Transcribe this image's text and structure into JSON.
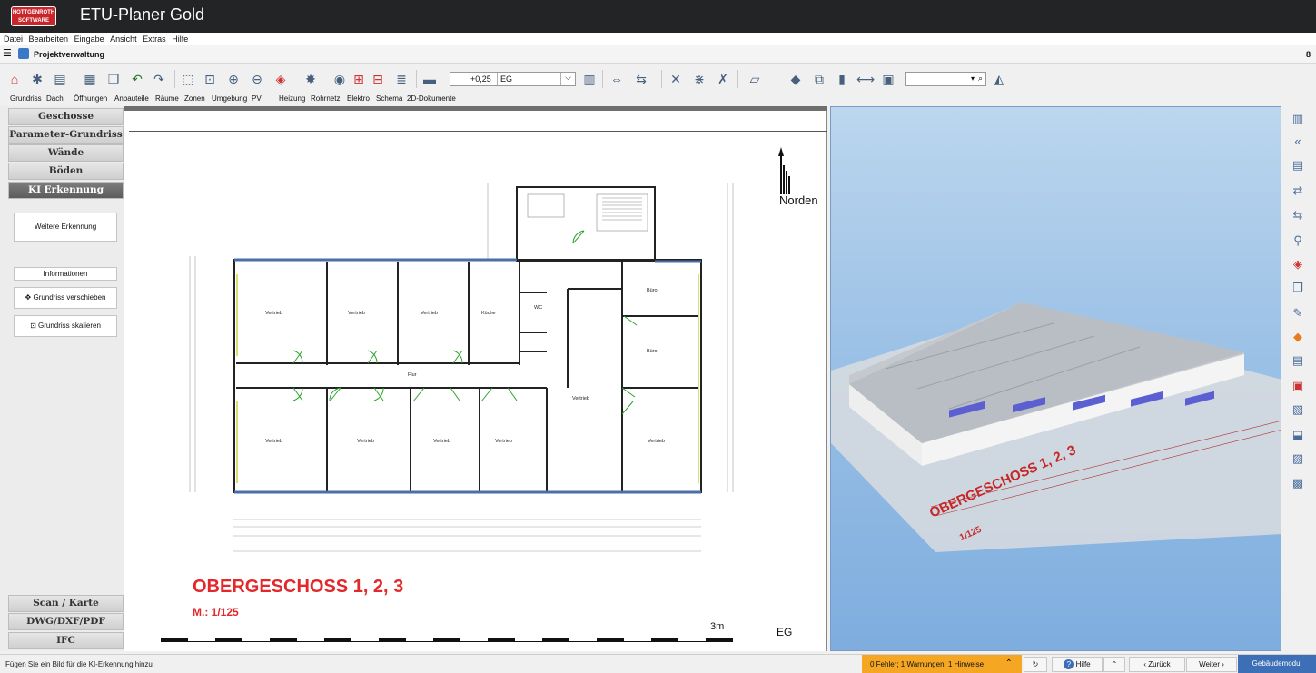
{
  "app": {
    "title": "ETU-Planer Gold",
    "logo_line1": "HOTTGENROTH",
    "logo_line2": "SOFTWARE"
  },
  "menu": [
    "Datei",
    "Bearbeiten",
    "Eingabe",
    "Ansicht",
    "Extras",
    "Hilfe"
  ],
  "project": {
    "title": "Projektverwaltung",
    "number": "8"
  },
  "toolbar": {
    "level_value": "+0,25",
    "level_name": "EG",
    "search_placeholder": ""
  },
  "tabs": [
    "Grundriss",
    "Dach",
    "Öffnungen",
    "Anbauteile",
    "Räume",
    "Zonen",
    "Umgebung",
    "PV",
    "Heizung",
    "Rohrnetz",
    "Elektro",
    "Schema",
    "2D-Dokumente"
  ],
  "left_nav": {
    "top": [
      "Geschosse",
      "Parameter-Grundriss",
      "Wände",
      "Böden",
      "KI Erkennung"
    ],
    "active": "KI Erkennung",
    "bottom": [
      "Scan / Karte",
      "DWG/DXF/PDF",
      "IFC"
    ]
  },
  "ki_panel": {
    "weitere": "Weitere Erkennung",
    "informationen": "Informationen",
    "verschieben": "Grundriss verschieben",
    "skalieren": "Grundriss skalieren"
  },
  "drawing": {
    "north_label": "Norden",
    "floor_title": "OBERGESCHOSS 1, 2, 3",
    "floor_scale": "M.: 1/125",
    "scale_text": "3m",
    "level_tag": "EG",
    "rooms": [
      "Vertrieb",
      "Vertrieb",
      "Vertrieb",
      "Küche",
      "WC",
      "Büro",
      "Büro",
      "Flur",
      "Vertrieb",
      "Vertrieb",
      "Vertrieb",
      "Vertrieb",
      "Vertrieb",
      "Vertrieb"
    ]
  },
  "view3d": {
    "floor_title": "OBERGESCHOSS 1, 2, 3",
    "floor_scale": "1/125"
  },
  "status": {
    "hint": "Fügen Sie ein Bild für die KI-Erkennung hinzu",
    "errors": "0 Fehler; 1 Warnungen; 1 Hinweise",
    "hilfe": "Hilfe",
    "zurueck": "Zurück",
    "weiter": "Weiter",
    "module": "Gebäudemodul"
  },
  "colors": {
    "titlebar": "#222425",
    "accent_red": "#e2282a",
    "status_orange": "#f5a623",
    "module_blue": "#3c6fb5"
  }
}
